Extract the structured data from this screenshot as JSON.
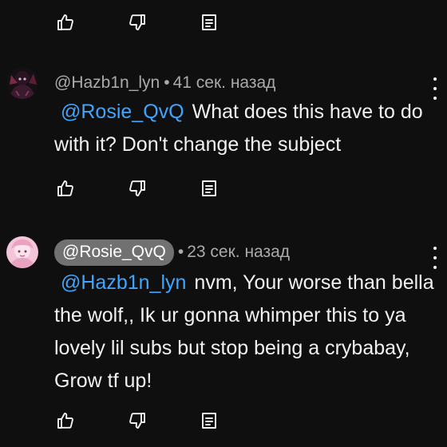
{
  "top_actions": {
    "like_icon": "thumb-up-icon",
    "dislike_icon": "thumb-down-icon",
    "reply_icon": "reply-icon"
  },
  "comments": [
    {
      "author": "@Hazb1n_lyn",
      "separator": "•",
      "time": "41 сек. назад",
      "mention": "@Rosie_QvQ",
      "text": "What does this have to do with it? Don't change the subject",
      "avatar_colors": [
        "#3a1a2e",
        "#7a2a44",
        "#c8b8d0"
      ]
    },
    {
      "author": "@Rosie_QvQ",
      "separator": "•",
      "time": "23 сек. назад",
      "mention": "@Hazb1n_lyn",
      "text": "nvm, Your worse than bella the wolf,, Ik ur gonna whimper this to ya lovely lil subs but stop being a crybabay, Grow tf up!",
      "avatar_colors": [
        "#f2c6d8",
        "#e9a3c0",
        "#fbe3ec"
      ]
    }
  ],
  "colors": {
    "background": "#0f0f0f",
    "text": "#f1f1f1",
    "meta": "#aaaaaa",
    "mention": "#3ea6ff",
    "author_pill": "#717171"
  }
}
